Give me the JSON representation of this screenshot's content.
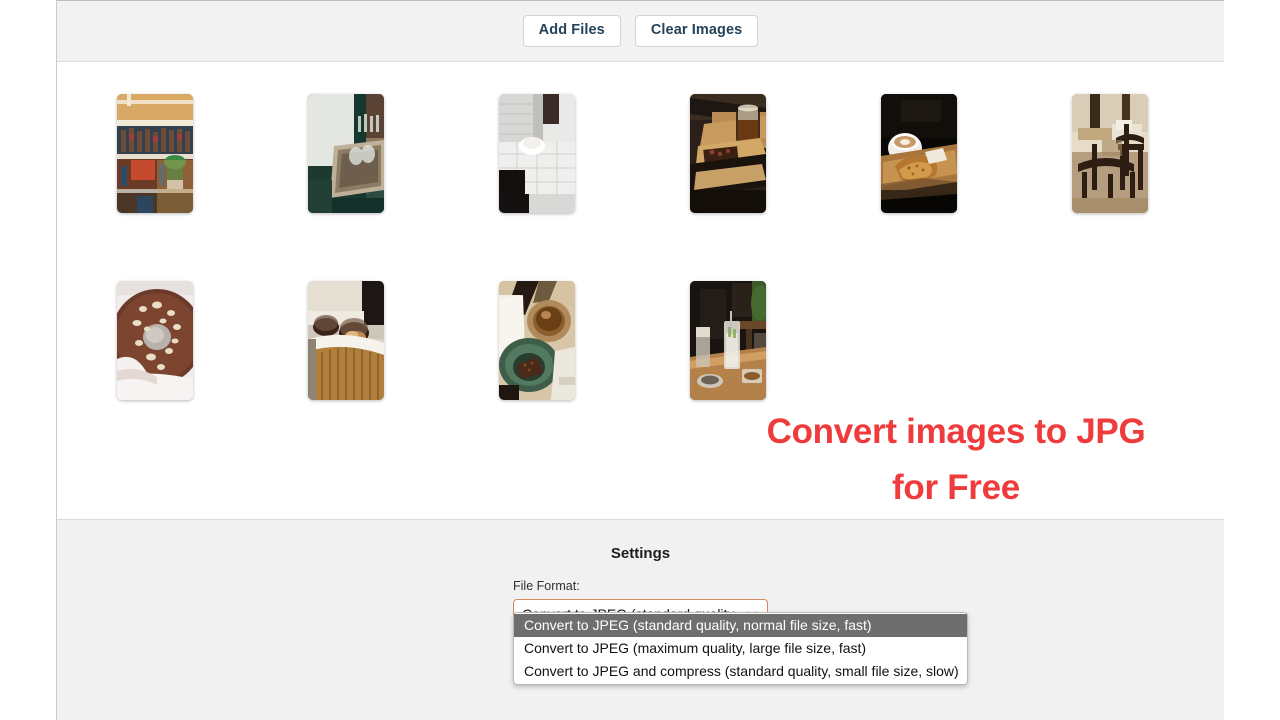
{
  "toolbar": {
    "add_files_label": "Add Files",
    "clear_images_label": "Clear Images"
  },
  "gallery": {
    "thumbnails": [
      {
        "alt": "bar shelves with bottles"
      },
      {
        "alt": "bar counter with hanging glasses"
      },
      {
        "alt": "white cup on tiled table"
      },
      {
        "alt": "iced coffee glass and food on wooden board"
      },
      {
        "alt": "cappuccino and croissant on dark table"
      },
      {
        "alt": "cafe interior with wooden chairs"
      },
      {
        "alt": "chocolate donut with nuts"
      },
      {
        "alt": "bakery counter with cake domes"
      },
      {
        "alt": "cake on green plate with iced coffee"
      },
      {
        "alt": "drinks on sunlit wooden table"
      }
    ]
  },
  "overlay": {
    "headline_line1": "Convert images to JPG",
    "headline_line2": "for Free",
    "headline_color": "#ef3b3b"
  },
  "settings": {
    "title": "Settings",
    "file_format_label": "File Format:",
    "selected_value": "Convert to JPEG (standard quality,",
    "chevron_icon": "chevron-down-icon",
    "options": [
      {
        "label": "Convert to JPEG (standard quality, normal file size, fast)",
        "selected": true
      },
      {
        "label": "Convert to JPEG (maximum quality, large file size, fast)",
        "selected": false
      },
      {
        "label": "Convert to JPEG and compress (standard quality, small file size, slow)",
        "selected": false
      }
    ]
  }
}
